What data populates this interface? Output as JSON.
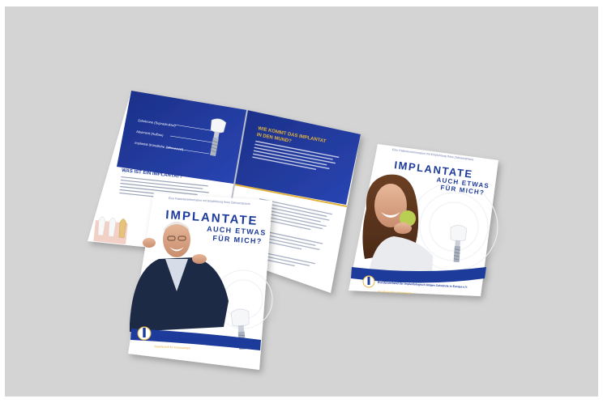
{
  "scene": {
    "background_color": "#d4d4d4",
    "accent_blue": "#1f3a9a",
    "accent_gold": "#e3b23c"
  },
  "open_brochure": {
    "left_page": {
      "labels": [
        "Zahnkrone (Suprastruktur)",
        "Abutment (Aufbau)",
        "Implantat (Künstliche Zahnwurzel)"
      ],
      "heading": "WAS IST EIN IMPLANTAT?"
    },
    "right_page": {
      "heading_line1": "WIE KOMMT DAS IMPLANTAT",
      "heading_line2": "IN DEN MUND?"
    }
  },
  "cover_front": {
    "top_note": "Eine Patienteninformation mit Empfehlung Ihres Zahnarztpraxis",
    "title": "IMPLANTATE",
    "subtitle_line1": "AUCH ETWAS",
    "subtitle_line2": "FÜR MICH?",
    "org_text": "Bundesverband der Implantologisch tätigen Zahnärzte in Europa e.V.",
    "org_subtext": "Gesellschaft für Implantologie"
  },
  "cover_right": {
    "top_note": "Eine Patienteninformation mit Empfehlung Ihres Zahnarztpraxis",
    "title": "IMPLANTATE",
    "subtitle_line1": "AUCH ETWAS",
    "subtitle_line2": "FÜR MICH?",
    "org_text": "Bundesverband der Implantologisch tätigen Zahnärzte in Europa e.V.",
    "org_subtext": "Gesellschaft für Implantologie"
  }
}
